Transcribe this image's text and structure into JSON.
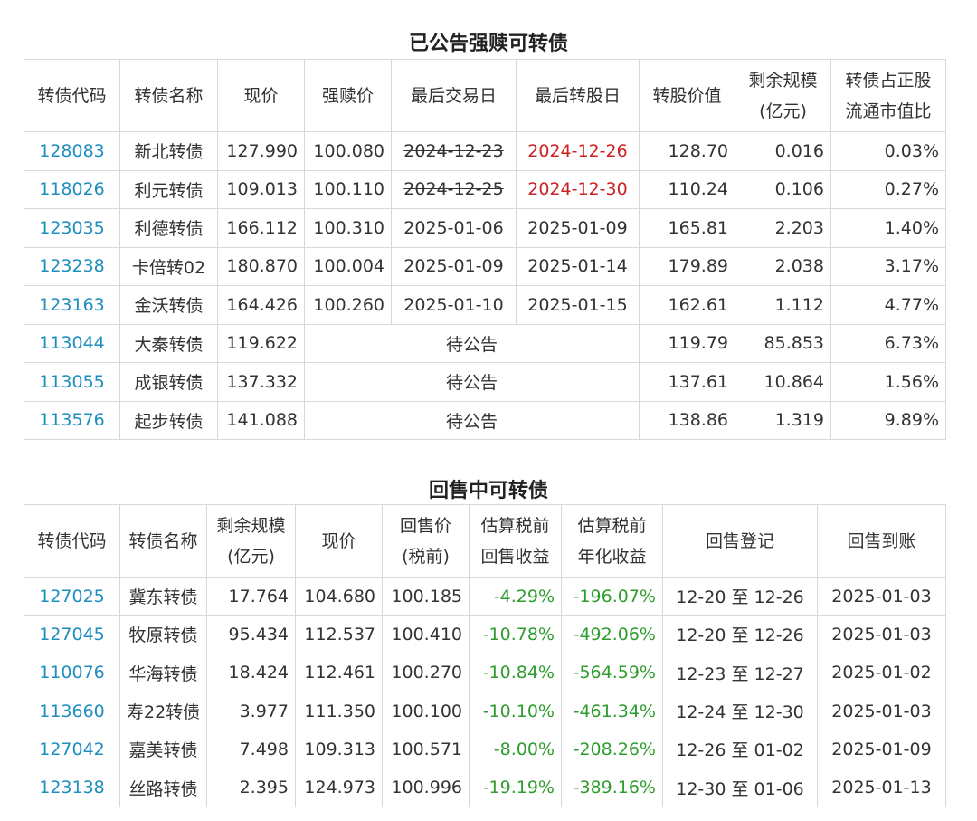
{
  "table1": {
    "title": "已公告强赎可转债",
    "headers": [
      "转债代码",
      "转债名称",
      "现价",
      "强赎价",
      "最后交易日",
      "最后转股日",
      "转股价值",
      "剩余规模\n(亿元)",
      "转债占正股\n流通市值比"
    ],
    "pending_label": "待公告",
    "rows": [
      {
        "code": "128083",
        "name": "新北转债",
        "price": "127.990",
        "redeem": "100.080",
        "last_trade": "2024-12-23",
        "last_trade_struck": true,
        "last_convert": "2024-12-26",
        "last_convert_red": true,
        "conv_value": "128.70",
        "remaining": "0.016",
        "ratio": "0.03%"
      },
      {
        "code": "118026",
        "name": "利元转债",
        "price": "109.013",
        "redeem": "100.110",
        "last_trade": "2024-12-25",
        "last_trade_struck": true,
        "last_convert": "2024-12-30",
        "last_convert_red": true,
        "conv_value": "110.24",
        "remaining": "0.106",
        "ratio": "0.27%"
      },
      {
        "code": "123035",
        "name": "利德转债",
        "price": "166.112",
        "redeem": "100.310",
        "last_trade": "2025-01-06",
        "last_trade_struck": false,
        "last_convert": "2025-01-09",
        "last_convert_red": false,
        "conv_value": "165.81",
        "remaining": "2.203",
        "ratio": "1.40%"
      },
      {
        "code": "123238",
        "name": "卡倍转02",
        "price": "180.870",
        "redeem": "100.004",
        "last_trade": "2025-01-09",
        "last_trade_struck": false,
        "last_convert": "2025-01-14",
        "last_convert_red": false,
        "conv_value": "179.89",
        "remaining": "2.038",
        "ratio": "3.17%"
      },
      {
        "code": "123163",
        "name": "金沃转债",
        "price": "164.426",
        "redeem": "100.260",
        "last_trade": "2025-01-10",
        "last_trade_struck": false,
        "last_convert": "2025-01-15",
        "last_convert_red": false,
        "conv_value": "162.61",
        "remaining": "1.112",
        "ratio": "4.77%"
      },
      {
        "code": "113044",
        "name": "大秦转债",
        "price": "119.622",
        "pending": true,
        "conv_value": "119.79",
        "remaining": "85.853",
        "ratio": "6.73%"
      },
      {
        "code": "113055",
        "name": "成银转债",
        "price": "137.332",
        "pending": true,
        "conv_value": "137.61",
        "remaining": "10.864",
        "ratio": "1.56%"
      },
      {
        "code": "113576",
        "name": "起步转债",
        "price": "141.088",
        "pending": true,
        "conv_value": "138.86",
        "remaining": "1.319",
        "ratio": "9.89%"
      }
    ]
  },
  "table2": {
    "title": "回售中可转债",
    "headers": [
      "转债代码",
      "转债名称",
      "剩余规模\n(亿元)",
      "现价",
      "回售价\n(税前)",
      "估算税前\n回售收益",
      "估算税前\n年化收益",
      "回售登记",
      "回售到账"
    ],
    "rows": [
      {
        "code": "127025",
        "name": "冀东转债",
        "remaining": "17.764",
        "price": "104.680",
        "putback": "100.185",
        "ret": "-4.29%",
        "annual": "-196.07%",
        "register": "12-20 至 12-26",
        "settle": "2025-01-03"
      },
      {
        "code": "127045",
        "name": "牧原转债",
        "remaining": "95.434",
        "price": "112.537",
        "putback": "100.410",
        "ret": "-10.78%",
        "annual": "-492.06%",
        "register": "12-20 至 12-26",
        "settle": "2025-01-03"
      },
      {
        "code": "110076",
        "name": "华海转债",
        "remaining": "18.424",
        "price": "112.461",
        "putback": "100.270",
        "ret": "-10.84%",
        "annual": "-564.59%",
        "register": "12-23 至 12-27",
        "settle": "2025-01-02"
      },
      {
        "code": "113660",
        "name": "寿22转债",
        "remaining": "3.977",
        "price": "111.350",
        "putback": "100.100",
        "ret": "-10.10%",
        "annual": "-461.34%",
        "register": "12-24 至 12-30",
        "settle": "2025-01-03"
      },
      {
        "code": "127042",
        "name": "嘉美转债",
        "remaining": "7.498",
        "price": "109.313",
        "putback": "100.571",
        "ret": "-8.00%",
        "annual": "-208.26%",
        "register": "12-26 至 01-02",
        "settle": "2025-01-09"
      },
      {
        "code": "123138",
        "name": "丝路转债",
        "remaining": "2.395",
        "price": "124.973",
        "putback": "100.996",
        "ret": "-19.19%",
        "annual": "-389.16%",
        "register": "12-30 至 01-06",
        "settle": "2025-01-13"
      }
    ]
  }
}
